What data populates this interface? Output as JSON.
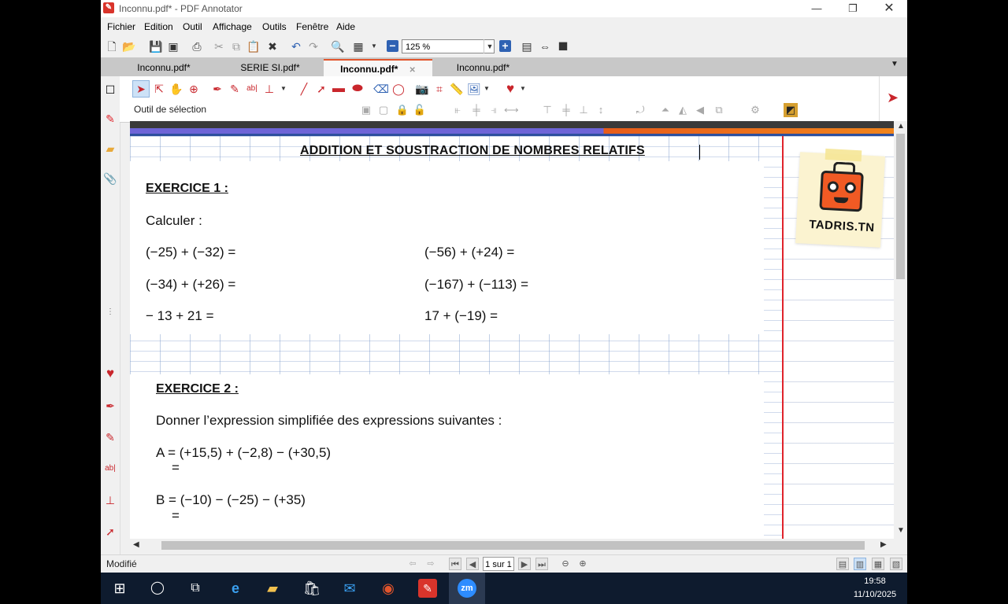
{
  "window": {
    "title": "Inconnu.pdf* - PDF Annotator"
  },
  "menu": [
    "Fichier",
    "Edition",
    "Outil",
    "Affichage",
    "Outils",
    "Fenêtre",
    "Aide"
  ],
  "toolbar": {
    "zoom_value": "125 %"
  },
  "tabs": [
    {
      "label": "Inconnu.pdf*",
      "active": false
    },
    {
      "label": "SERIE SI.pdf*",
      "active": false
    },
    {
      "label": "Inconnu.pdf*",
      "active": true
    },
    {
      "label": "Inconnu.pdf*",
      "active": false
    }
  ],
  "annotation_toolbar": {
    "tool_label": "Outil de sélection"
  },
  "document": {
    "title": "ADDITION ET SOUSTRACTION DE NOMBRES RELATIFS",
    "exercise1": {
      "heading": "EXERCICE 1 :",
      "instruction": "Calculer :",
      "items": [
        "(−25) + (−32) =",
        "(−56) + (+24) =",
        "(−34) + (+26) =",
        "(−167) + (−113) =",
        "− 13 + 21 =",
        "17 + (−19) ="
      ]
    },
    "exercise2": {
      "heading": "EXERCICE 2 :",
      "instruction": "Donner l’expression simplifiée des expressions suivantes :",
      "expr_a": "A = (+15,5) + (−2,8) − (+30,5)",
      "expr_a_eq": "=",
      "expr_b": "B = (−10) − (−25) − (+35)",
      "expr_b_eq": "="
    },
    "logo_text": "TADRIS.TN"
  },
  "status": {
    "text": "Modifié",
    "page": "1 sur 1"
  },
  "taskbar": {
    "time": "19:58",
    "date": "11/10/2025"
  },
  "colors": {
    "accent_tab": "#e2552c",
    "margin_red": "#e0232b",
    "logo_orange": "#f15a24",
    "taskbar": "#0e1b2e"
  }
}
